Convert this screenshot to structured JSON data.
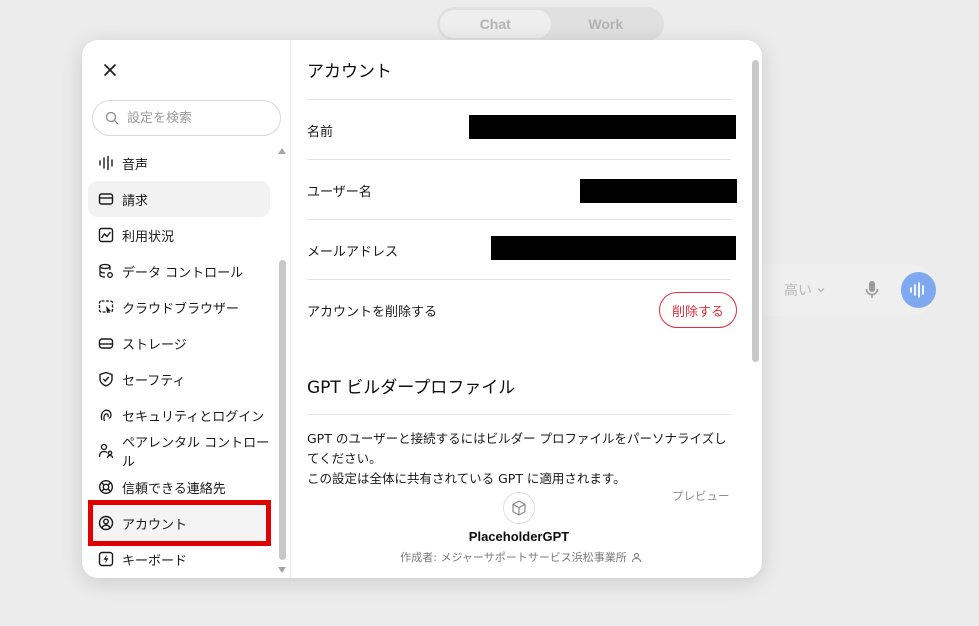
{
  "background": {
    "mode_tabs": [
      {
        "label": "Chat",
        "active": true
      },
      {
        "label": "Work",
        "active": false
      }
    ],
    "composer": {
      "model_label": "高い"
    }
  },
  "modal": {
    "search": {
      "placeholder": "設定を検索"
    },
    "nav": {
      "items": [
        {
          "label": "音声",
          "icon": "voice-wave-icon"
        },
        {
          "label": "請求",
          "icon": "credit-card-icon"
        },
        {
          "label": "利用状況",
          "icon": "usage-chart-icon"
        },
        {
          "label": "データ コントロール",
          "icon": "database-gear-icon"
        },
        {
          "label": "クラウドブラウザー",
          "icon": "cloud-browser-icon"
        },
        {
          "label": "ストレージ",
          "icon": "storage-drive-icon"
        },
        {
          "label": "セーフティ",
          "icon": "shield-check-icon"
        },
        {
          "label": "セキュリティとログイン",
          "icon": "fingerprint-icon"
        },
        {
          "label": "ペアレンタル コントロール",
          "icon": "parent-child-icon"
        },
        {
          "label": "信頼できる連絡先",
          "icon": "lifebuoy-icon"
        },
        {
          "label": "アカウント",
          "icon": "user-circle-icon",
          "active": true
        },
        {
          "label": "キーボード",
          "icon": "keyboard-lightning-icon"
        }
      ],
      "highlight_color": "#e00000"
    },
    "account": {
      "title": "アカウント",
      "name_label": "名前",
      "username_label": "ユーザー名",
      "email_label": "メールアドレス",
      "delete_label": "アカウントを削除する",
      "delete_button": "削除する",
      "delete_color": "#e02e3a"
    },
    "gpt_profile": {
      "title": "GPT ビルダープロファイル",
      "description_line1": "GPT のユーザーと接続するにはビルダー プロファイルをパーソナライズしてください。",
      "description_line2": "この設定は全体に共有されている GPT に適用されます。",
      "preview_label": "プレビュー",
      "gpt_name": "PlaceholderGPT",
      "author": "作成者: メジャーサポートサービス浜松事業所"
    }
  }
}
